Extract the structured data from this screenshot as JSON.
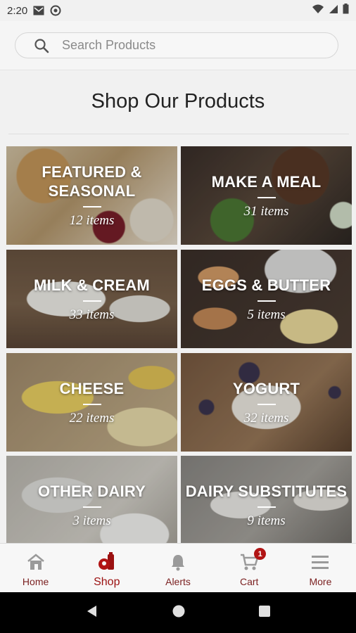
{
  "status_bar": {
    "time": "2:20"
  },
  "search": {
    "placeholder": "Search Products"
  },
  "page_title": "Shop Our Products",
  "categories": [
    {
      "title": "FEATURED & SEASONAL",
      "count": "12 items"
    },
    {
      "title": "MAKE A MEAL",
      "count": "31 items"
    },
    {
      "title": "MILK & CREAM",
      "count": "33 items"
    },
    {
      "title": "EGGS & BUTTER",
      "count": "5 items"
    },
    {
      "title": "CHEESE",
      "count": "22 items"
    },
    {
      "title": "YOGURT",
      "count": "32 items"
    },
    {
      "title": "OTHER DAIRY",
      "count": "3 items"
    },
    {
      "title": "DAIRY SUBSTITUTES",
      "count": "9 items"
    }
  ],
  "bottom_nav": {
    "items": [
      {
        "label": "Home",
        "icon": "home-icon"
      },
      {
        "label": "Shop",
        "icon": "shop-icon",
        "active": true
      },
      {
        "label": "Alerts",
        "icon": "bell-icon"
      },
      {
        "label": "Cart",
        "icon": "cart-icon",
        "badge": "1"
      },
      {
        "label": "More",
        "icon": "menu-icon"
      }
    ]
  },
  "colors": {
    "brand": "#9b1111",
    "badge": "#b11414",
    "background": "#f1f1f1"
  }
}
